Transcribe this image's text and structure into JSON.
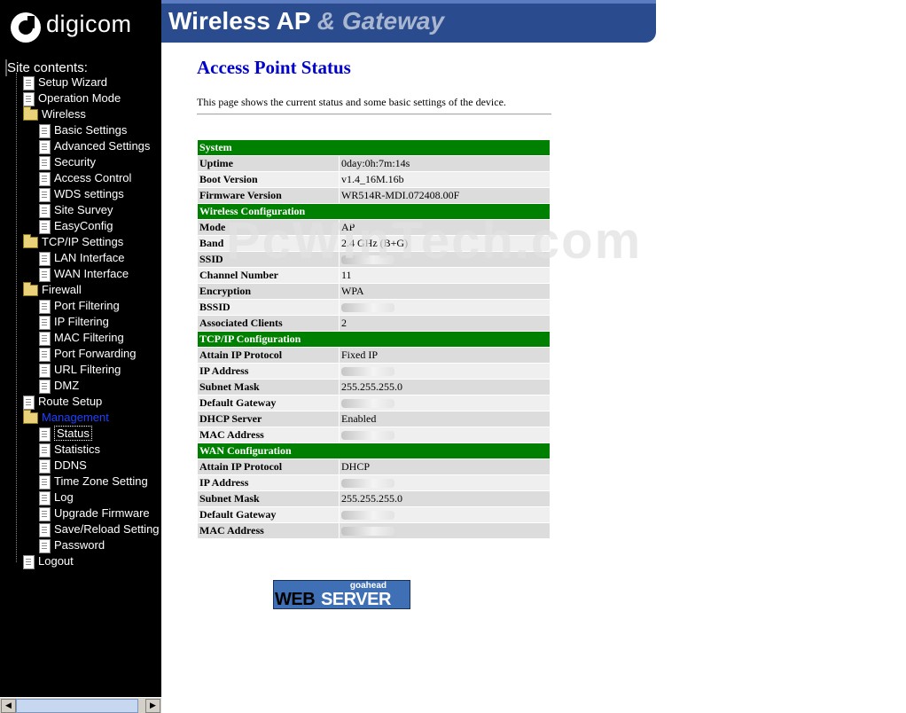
{
  "header": {
    "logo": "digicom",
    "title_main": "Wireless AP",
    "title_amp": "& Gateway"
  },
  "sidebar": {
    "title": "Site contents:",
    "items": [
      {
        "label": "Setup Wizard",
        "type": "doc",
        "level": 1
      },
      {
        "label": "Operation Mode",
        "type": "doc",
        "level": 1
      },
      {
        "label": "Wireless",
        "type": "folder",
        "level": 1
      },
      {
        "label": "Basic Settings",
        "type": "doc",
        "level": 2
      },
      {
        "label": "Advanced Settings",
        "type": "doc",
        "level": 2
      },
      {
        "label": "Security",
        "type": "doc",
        "level": 2
      },
      {
        "label": "Access Control",
        "type": "doc",
        "level": 2
      },
      {
        "label": "WDS settings",
        "type": "doc",
        "level": 2
      },
      {
        "label": "Site Survey",
        "type": "doc",
        "level": 2
      },
      {
        "label": "EasyConfig",
        "type": "doc",
        "level": 2
      },
      {
        "label": "TCP/IP Settings",
        "type": "folder",
        "level": 1
      },
      {
        "label": "LAN Interface",
        "type": "doc",
        "level": 2
      },
      {
        "label": "WAN Interface",
        "type": "doc",
        "level": 2
      },
      {
        "label": "Firewall",
        "type": "folder",
        "level": 1
      },
      {
        "label": "Port Filtering",
        "type": "doc",
        "level": 2
      },
      {
        "label": "IP Filtering",
        "type": "doc",
        "level": 2
      },
      {
        "label": "MAC Filtering",
        "type": "doc",
        "level": 2
      },
      {
        "label": "Port Forwarding",
        "type": "doc",
        "level": 2
      },
      {
        "label": "URL Filtering",
        "type": "doc",
        "level": 2
      },
      {
        "label": "DMZ",
        "type": "doc",
        "level": 2
      },
      {
        "label": "Route Setup",
        "type": "doc",
        "level": 1
      },
      {
        "label": "Management",
        "type": "folder",
        "level": 1,
        "active": true
      },
      {
        "label": "Status",
        "type": "doc",
        "level": 2,
        "selected": true
      },
      {
        "label": "Statistics",
        "type": "doc",
        "level": 2
      },
      {
        "label": "DDNS",
        "type": "doc",
        "level": 2
      },
      {
        "label": "Time Zone Setting",
        "type": "doc",
        "level": 2
      },
      {
        "label": "Log",
        "type": "doc",
        "level": 2
      },
      {
        "label": "Upgrade Firmware",
        "type": "doc",
        "level": 2
      },
      {
        "label": "Save/Reload Setting",
        "type": "doc",
        "level": 2
      },
      {
        "label": "Password",
        "type": "doc",
        "level": 2
      },
      {
        "label": "Logout",
        "type": "doc",
        "level": 1
      }
    ]
  },
  "main": {
    "title": "Access Point Status",
    "description": "This page shows the current status and some basic settings of the device.",
    "sections": [
      {
        "title": "System",
        "rows": [
          {
            "label": "Uptime",
            "value": "0day:0h:7m:14s"
          },
          {
            "label": "Boot Version",
            "value": "v1.4_16M.16b"
          },
          {
            "label": "Firmware Version",
            "value": "WR514R-MDI.072408.00F"
          }
        ]
      },
      {
        "title": "Wireless Configuration",
        "rows": [
          {
            "label": "Mode",
            "value": "AP"
          },
          {
            "label": "Band",
            "value": "2.4 GHz (B+G)"
          },
          {
            "label": "SSID",
            "value": "",
            "redacted": true
          },
          {
            "label": "Channel Number",
            "value": "11"
          },
          {
            "label": "Encryption",
            "value": "WPA"
          },
          {
            "label": "BSSID",
            "value": "",
            "redacted": true
          },
          {
            "label": "Associated Clients",
            "value": "2"
          }
        ]
      },
      {
        "title": "TCP/IP Configuration",
        "rows": [
          {
            "label": "Attain IP Protocol",
            "value": "Fixed IP"
          },
          {
            "label": "IP Address",
            "value": "",
            "redacted": true
          },
          {
            "label": "Subnet Mask",
            "value": "255.255.255.0"
          },
          {
            "label": "Default Gateway",
            "value": "",
            "redacted": true
          },
          {
            "label": "DHCP Server",
            "value": "Enabled"
          },
          {
            "label": "MAC Address",
            "value": "",
            "redacted": true
          }
        ]
      },
      {
        "title": "WAN Configuration",
        "rows": [
          {
            "label": "Attain IP Protocol",
            "value": "DHCP"
          },
          {
            "label": "IP Address",
            "value": "",
            "redacted": true
          },
          {
            "label": "Subnet Mask",
            "value": "255.255.255.0"
          },
          {
            "label": "Default Gateway",
            "value": "",
            "redacted": true
          },
          {
            "label": "MAC Address",
            "value": "",
            "redacted": true
          }
        ]
      }
    ]
  },
  "watermark": "PcWinTech.com",
  "badge": {
    "top": "goahead",
    "web": "WEB",
    "server": "SERVER"
  },
  "colors": {
    "section_bg": "#008000",
    "banner_bg": "#2a4c8e",
    "title": "#0000cc",
    "active_folder": "#2040ff"
  }
}
